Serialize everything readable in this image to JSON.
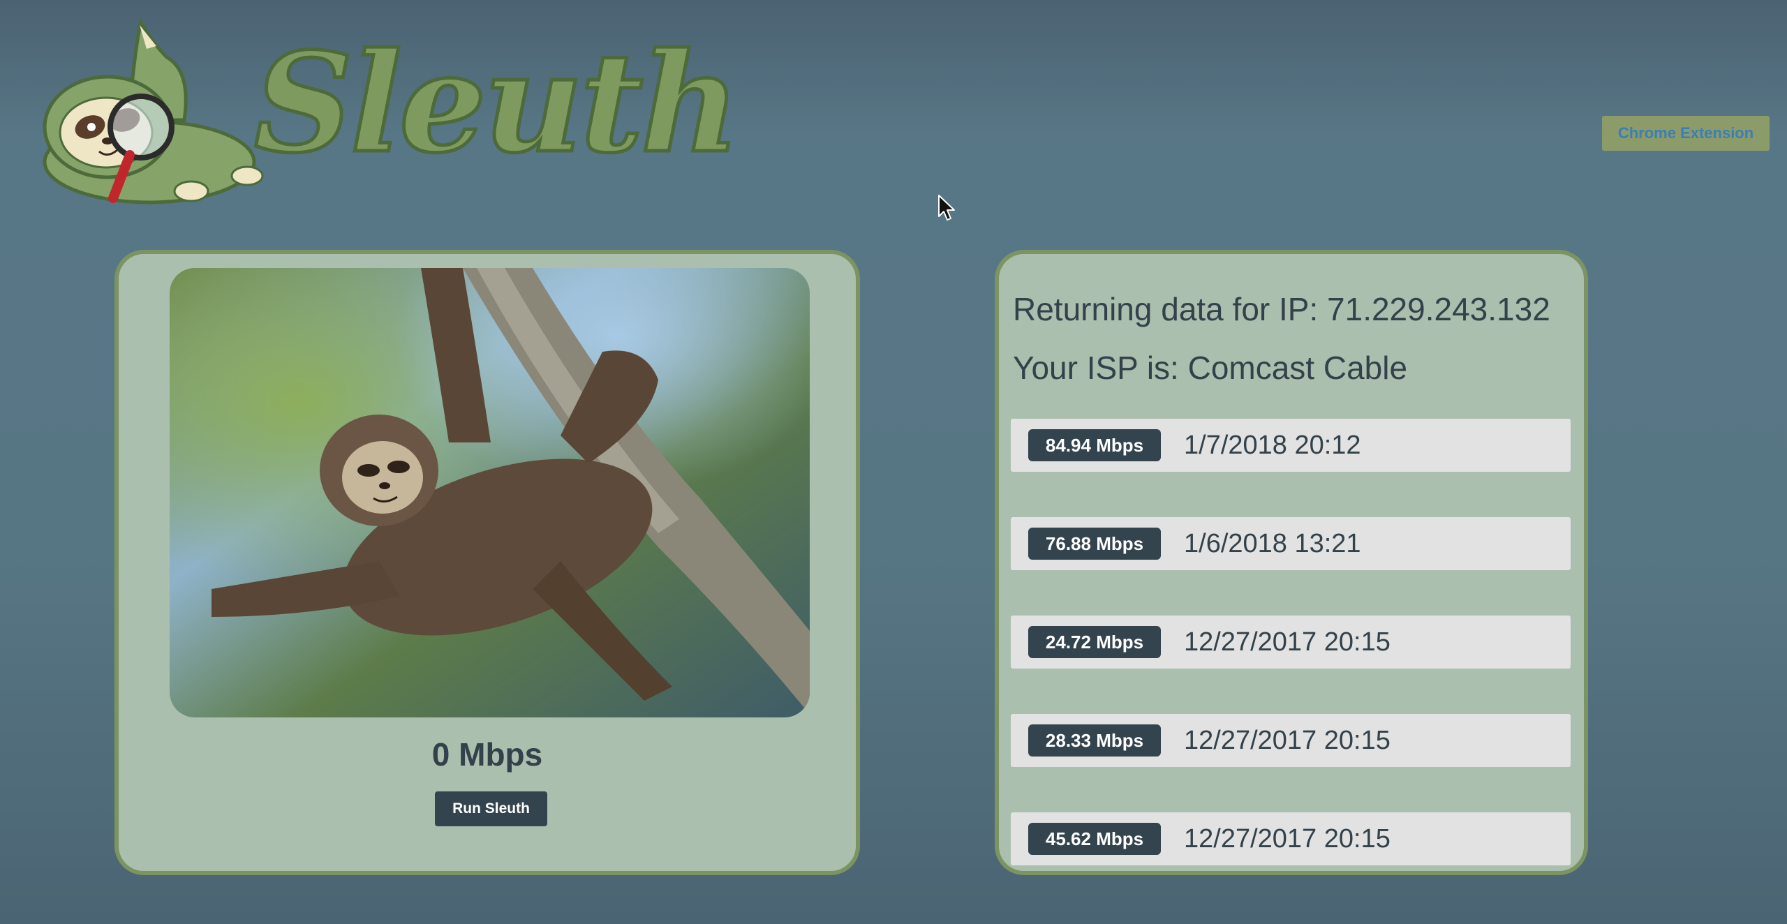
{
  "header": {
    "logo_text": "Sleuth",
    "chrome_extension_label": "Chrome Extension"
  },
  "tester": {
    "speed_display": "0 Mbps",
    "run_button_label": "Run Sleuth"
  },
  "info": {
    "ip_line": "Returning data for IP: 71.229.243.132",
    "isp_line": "Your ISP is: Comcast Cable"
  },
  "history": [
    {
      "speed": "84.94 Mbps",
      "timestamp": "1/7/2018 20:12"
    },
    {
      "speed": "76.88 Mbps",
      "timestamp": "1/6/2018 13:21"
    },
    {
      "speed": "24.72 Mbps",
      "timestamp": "12/27/2017 20:15"
    },
    {
      "speed": "28.33 Mbps",
      "timestamp": "12/27/2017 20:15"
    },
    {
      "speed": "45.62 Mbps",
      "timestamp": "12/27/2017 20:15"
    }
  ],
  "colors": {
    "background": "#577684",
    "panel": "#abbfae",
    "panel_border": "#7c9462",
    "dark": "#34444e",
    "logo_green": "#7e9a5e",
    "extension_button": "#8b9b69",
    "extension_text": "#3a7fb8"
  },
  "icons": {
    "logo_mascot": "sloth-with-magnifying-glass-icon",
    "cursor": "mouse-pointer-icon"
  }
}
